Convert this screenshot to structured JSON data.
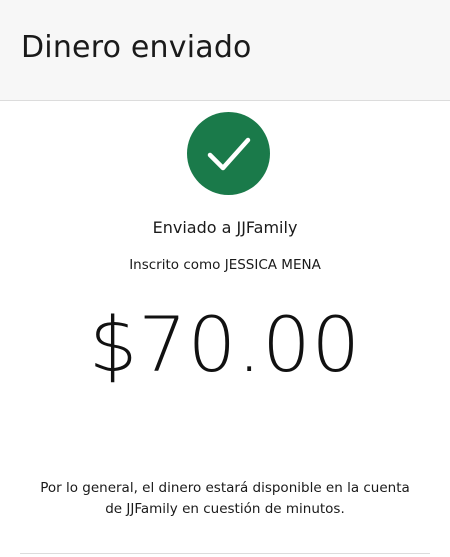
{
  "header": {
    "title": "Dinero enviado"
  },
  "status": {
    "icon": "checkmark-icon",
    "color": "#1a7a4a"
  },
  "recipient": {
    "sent_to": "Enviado a JJFamily",
    "enrolled_as": "Inscrito como JESSICA MENA"
  },
  "payment": {
    "amount": "$70.00"
  },
  "info": {
    "note_line1": "Por lo general, el dinero estará disponible en la cuenta",
    "note_line2": "de JJFamily en cuestión de minutos."
  }
}
